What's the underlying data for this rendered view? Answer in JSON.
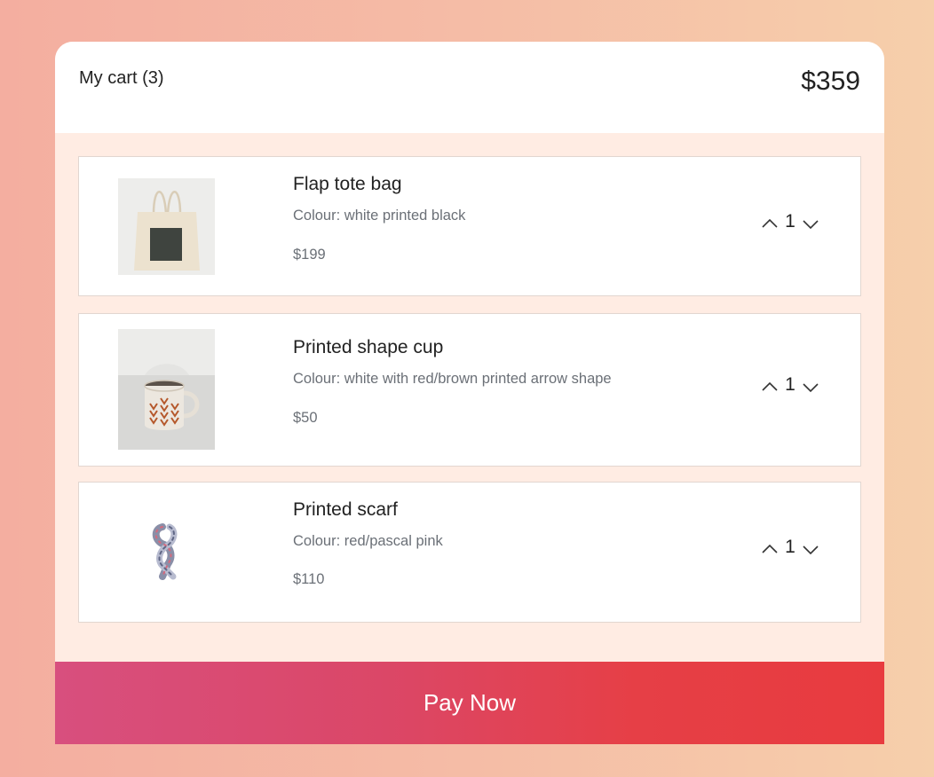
{
  "cart": {
    "title": "My cart (3)",
    "total": "$359"
  },
  "items": [
    {
      "name": "Flap tote bag",
      "colour": "Colour: white printed black",
      "price": "$199",
      "quantity": "1",
      "image_icon": "tote-bag-image"
    },
    {
      "name": "Printed shape cup",
      "colour": "Colour: white with red/brown printed arrow shape",
      "price": "$50",
      "quantity": "1",
      "image_icon": "cup-image"
    },
    {
      "name": "Printed scarf",
      "colour": "Colour: red/pascal pink",
      "price": "$110",
      "quantity": "1",
      "image_icon": "scarf-image"
    }
  ],
  "actions": {
    "pay_label": "Pay Now"
  },
  "colors": {
    "accent_start": "#d84f7e",
    "accent_end": "#e83b3f",
    "card_background": "#ffece3"
  }
}
